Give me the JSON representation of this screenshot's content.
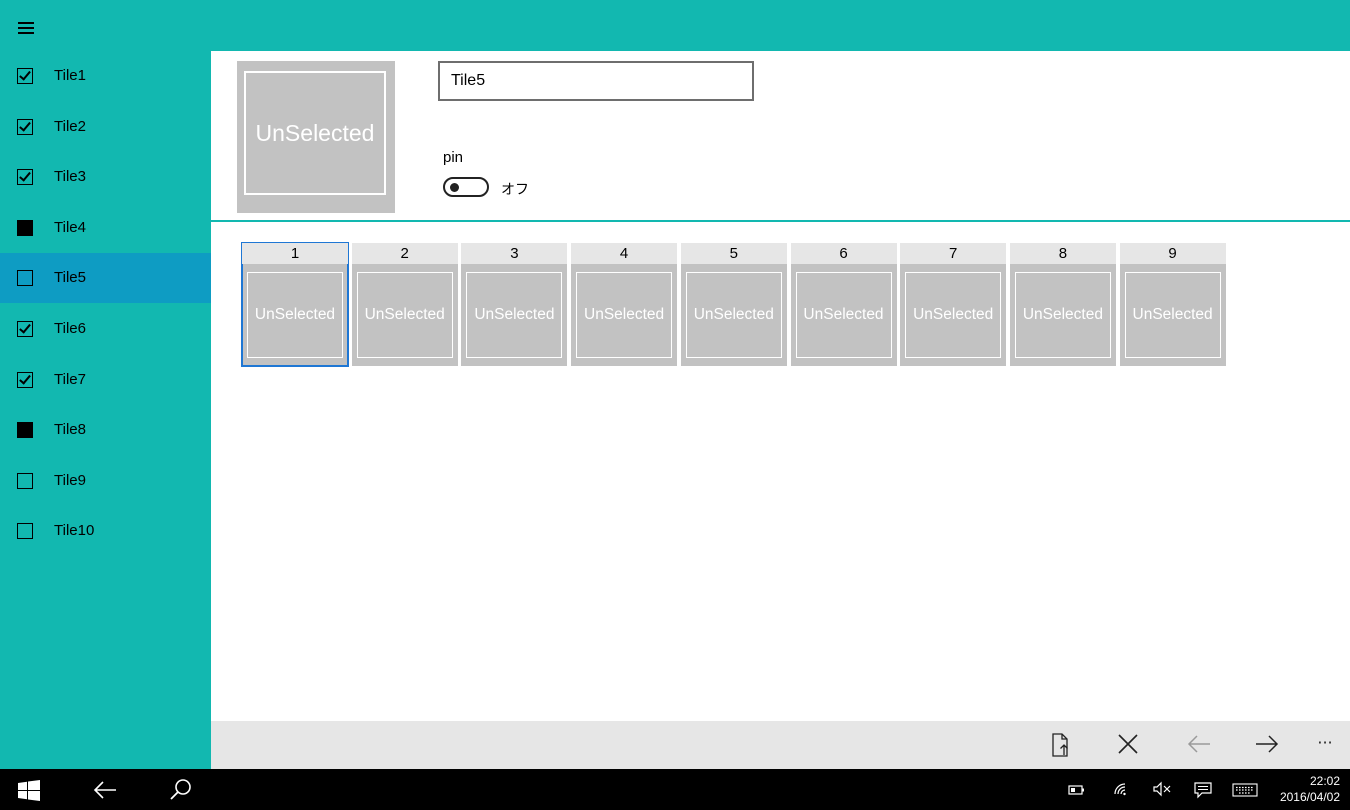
{
  "sidebar": {
    "items": [
      {
        "label": "Tile1",
        "state": "checked"
      },
      {
        "label": "Tile2",
        "state": "checked"
      },
      {
        "label": "Tile3",
        "state": "checked"
      },
      {
        "label": "Tile4",
        "state": "indeterminate"
      },
      {
        "label": "Tile5",
        "state": "unchecked"
      },
      {
        "label": "Tile6",
        "state": "checked"
      },
      {
        "label": "Tile7",
        "state": "checked"
      },
      {
        "label": "Tile8",
        "state": "indeterminate"
      },
      {
        "label": "Tile9",
        "state": "unchecked"
      },
      {
        "label": "Tile10",
        "state": "unchecked"
      }
    ],
    "selected_index": 4
  },
  "detail": {
    "preview_text": "UnSelected",
    "name_value": "Tile5",
    "pin_label": "pin",
    "toggle_state": "オフ"
  },
  "grid": {
    "tiles": [
      {
        "number": "1",
        "text": "UnSelected"
      },
      {
        "number": "2",
        "text": "UnSelected"
      },
      {
        "number": "3",
        "text": "UnSelected"
      },
      {
        "number": "4",
        "text": "UnSelected"
      },
      {
        "number": "5",
        "text": "UnSelected"
      },
      {
        "number": "6",
        "text": "UnSelected"
      },
      {
        "number": "7",
        "text": "UnSelected"
      },
      {
        "number": "8",
        "text": "UnSelected"
      },
      {
        "number": "9",
        "text": "UnSelected"
      }
    ],
    "focused_index": 0
  },
  "commandbar": {
    "more_label": "···"
  },
  "taskbar": {
    "time": "22:02",
    "date": "2016/04/02"
  },
  "colors": {
    "accent": "#12b8b0",
    "selected": "#0e9cc3",
    "tile": "#c2c2c2",
    "focus": "#1f77d4"
  }
}
